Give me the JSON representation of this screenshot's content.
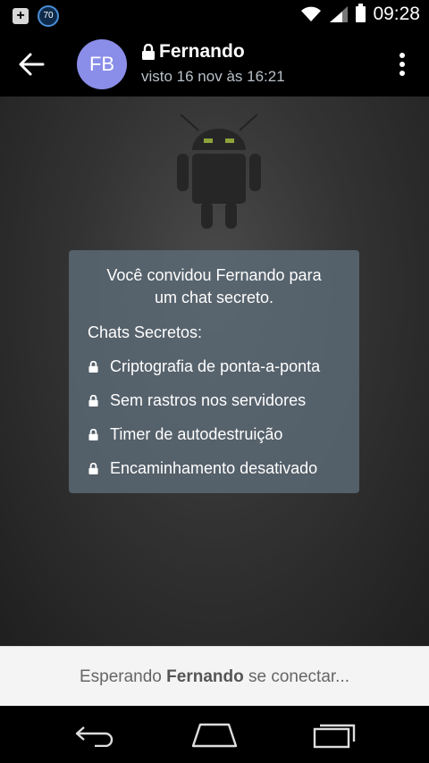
{
  "status_bar": {
    "left_icons": [
      "plus-notification-icon",
      "speed-70-icon"
    ],
    "badge_text": "70",
    "time": "09:28",
    "right_icons": [
      "wifi-icon",
      "signal-icon",
      "battery-icon"
    ]
  },
  "header": {
    "avatar_initials": "FB",
    "title": "Fernando",
    "subtitle": "visto 16 nov às 16:21",
    "icons": [
      "back-arrow-icon",
      "lock-icon",
      "overflow-menu-icon"
    ]
  },
  "secret_chat_card": {
    "intro_line1": "Você convidou Fernando para",
    "intro_line2": "um chat secreto.",
    "heading": "Chats Secretos:",
    "features": [
      "Criptografia de ponta-a-ponta",
      "Sem rastros nos servidores",
      "Timer de autodestruição",
      "Encaminhamento desativado"
    ]
  },
  "bottom_bar": {
    "prefix": "Esperando",
    "name": "Fernando",
    "suffix": "se conectar..."
  },
  "nav_bar": {
    "icons": [
      "nav-back-icon",
      "nav-home-icon",
      "nav-recents-icon"
    ]
  },
  "colors": {
    "avatar": "#8a8ee8",
    "card": "#5c6a76",
    "bottom_bar": "#f4f4f4"
  }
}
